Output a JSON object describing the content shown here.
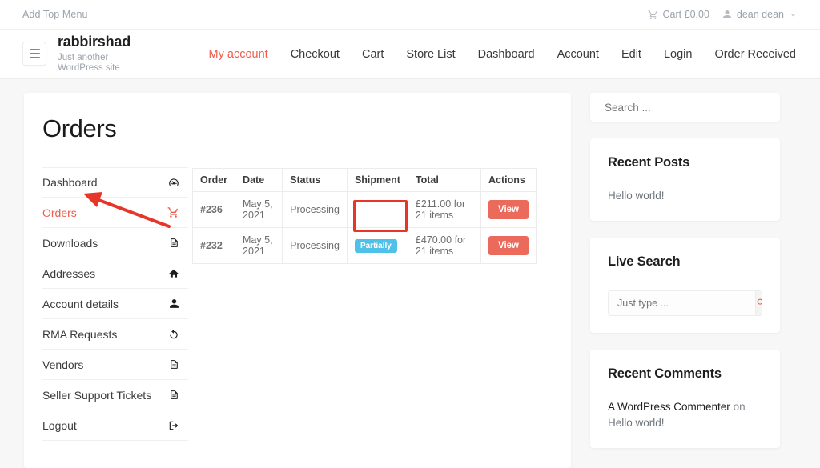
{
  "topbar": {
    "menu_label": "Add Top Menu",
    "cart_label": "Cart £0.00",
    "cart_icon": "shopping-cart-icon",
    "user_label": "dean dean",
    "user_icon": "user-icon",
    "chevron_icon": "chevron-down-icon"
  },
  "header": {
    "menu_toggle_icon": "hamburger-icon",
    "site_title": "rabbirshad",
    "site_tagline": "Just another WordPress site",
    "nav": [
      {
        "label": "My account",
        "active": true
      },
      {
        "label": "Checkout",
        "active": false
      },
      {
        "label": "Cart",
        "active": false
      },
      {
        "label": "Store List",
        "active": false
      },
      {
        "label": "Dashboard",
        "active": false
      },
      {
        "label": "Account",
        "active": false
      },
      {
        "label": "Edit",
        "active": false
      },
      {
        "label": "Login",
        "active": false
      },
      {
        "label": "Order Received",
        "active": false
      }
    ]
  },
  "main": {
    "page_title": "Orders",
    "account_nav": [
      {
        "label": "Dashboard",
        "icon": "gauge-icon",
        "active": false
      },
      {
        "label": "Orders",
        "icon": "shopping-cart-icon",
        "active": true
      },
      {
        "label": "Downloads",
        "icon": "document-icon",
        "active": false
      },
      {
        "label": "Addresses",
        "icon": "home-icon",
        "active": false
      },
      {
        "label": "Account details",
        "icon": "user-icon",
        "active": false
      },
      {
        "label": "RMA Requests",
        "icon": "undo-arrow-icon",
        "active": false
      },
      {
        "label": "Vendors",
        "icon": "document-icon",
        "active": false
      },
      {
        "label": "Seller Support Tickets",
        "icon": "document-icon",
        "active": false
      },
      {
        "label": "Logout",
        "icon": "sign-out-icon",
        "active": false
      }
    ],
    "orders_table": {
      "columns": [
        "Order",
        "Date",
        "Status",
        "Shipment",
        "Total",
        "Actions"
      ],
      "rows": [
        {
          "order": "#236",
          "date": "May 5, 2021",
          "status": "Processing",
          "shipment": "--",
          "shipment_badge": false,
          "total": "£211.00 for 21 items",
          "action": "View"
        },
        {
          "order": "#232",
          "date": "May 5, 2021",
          "status": "Processing",
          "shipment": "Partially",
          "shipment_badge": true,
          "total": "£470.00 for 21 items",
          "action": "View"
        }
      ]
    }
  },
  "sidebar": {
    "search_placeholder": "Search ...",
    "search_value": "",
    "widgets": [
      {
        "title": "Recent Posts",
        "links": [
          "Hello world!"
        ]
      },
      {
        "title": "Live Search",
        "input_placeholder": "Just type ...",
        "input_value": "",
        "button_icon": "search-icon"
      },
      {
        "title": "Recent Comments",
        "comment_author": "A WordPress Commenter",
        "comment_on": " on ",
        "comment_post": "Hello world!"
      }
    ]
  },
  "annotations": {
    "arrow_color": "#e8352a",
    "highlight_color": "#e8352a",
    "arrow_target": "Orders",
    "highlight_target": "shipment-badge"
  },
  "colors": {
    "accent": "#ef5b4c",
    "button": "#ec6a5c",
    "badge": "#4fc0e8",
    "page_bg": "#f7f7f7",
    "annotation": "#e8352a"
  }
}
